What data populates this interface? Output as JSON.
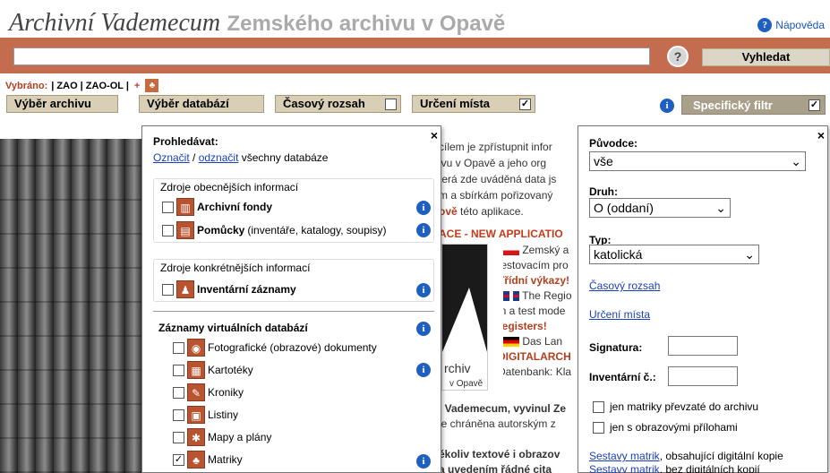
{
  "header": {
    "title_script": "Archivní Vademecum",
    "title_bold": "Zemského archivu v Opavě",
    "help_label": "Nápověda"
  },
  "search": {
    "value": "",
    "button_label": "Vyhledat"
  },
  "selected": {
    "label": "Vybráno:",
    "values": "| ZAO | ZAO-OL |",
    "plus": "+"
  },
  "tabs": {
    "archive": "Výběr archivu",
    "database": "Výběr databází",
    "time": "Časový rozsah",
    "place": "Určení místa",
    "place_checked": "✓",
    "specific": "Specifický filtr",
    "specific_checked": "✓"
  },
  "background": {
    "intro_lines": [
      "cílem je zpřístupnit infor",
      "ivu v Opavě a jeho org",
      "terá zde uváděná data js",
      "m a sbírkám pořizovaný",
      "ově"
    ],
    "intro_suffix": " této aplikace.",
    "new_app": "ACE - NEW APPLICATIO",
    "lang_lines": [
      "Zemský a",
      "testovacím pro",
      "Třídní výkazy!",
      "The Regio",
      "in a test mode",
      "registers!",
      "Das Lan",
      "DIGITALARCH",
      "Datenbank: Kla"
    ],
    "logo_text": "rchiv",
    "logo_sub": "v Opavě",
    "vadem_lines": [
      "i Vademecum, vyvinul Ze",
      "je chráněna autorským z",
      "",
      "ěkoliv textové i obrazov",
      "a uvedením řádné cita"
    ]
  },
  "left_panel": {
    "search_label": "Prohledávat:",
    "select_all": "Označit",
    "separator": " / ",
    "deselect": "odznačit",
    "all_db": " všechny databáze",
    "close": "×",
    "group1": {
      "title": "Zdroje obecnějších informací",
      "items": [
        {
          "label": "Archivní fondy",
          "extra": "",
          "checked": ""
        },
        {
          "label": "Pomůcky",
          "extra": " (inventáře, katalogy, soupisy)",
          "checked": ""
        }
      ]
    },
    "group2": {
      "title": "Zdroje konkrétnějších informací",
      "items": [
        {
          "label": "Inventární záznamy",
          "checked": ""
        }
      ]
    },
    "group3": {
      "title": "Záznamy virtuálních databází",
      "items": [
        {
          "label": "Fotografické (obrazové) dokumenty",
          "checked": ""
        },
        {
          "label": "Kartotéky",
          "checked": ""
        },
        {
          "label": "Kroniky",
          "checked": ""
        },
        {
          "label": "Listiny",
          "checked": ""
        },
        {
          "label": "Mapy a plány",
          "checked": ""
        },
        {
          "label": "Matriky",
          "checked": "✓"
        }
      ]
    }
  },
  "right_panel": {
    "close": "×",
    "originator_label": "Původce:",
    "originator_value": "vše",
    "type_label": "Druh:",
    "type_value": "O (oddaní)",
    "kind_label": "Typ:",
    "kind_value": "katolická",
    "time_link": "Časový rozsah",
    "place_link": "Určení místa",
    "signature_label": "Signatura:",
    "inventory_label": "Inventární č.:",
    "cb1": "jen matriky převzaté do archivu",
    "cb2": "jen s obrazovými přílohami",
    "sets1_link": "Sestavy matrik",
    "sets1_text": ", obsahující digitální kopie",
    "sets2_link": "Sestavy matrik",
    "sets2_text": ", bez digitálních kopií"
  },
  "colors": {
    "brand": "#c46d4e",
    "button_bg": "#d8cfb6",
    "link": "#1a3fb8"
  }
}
